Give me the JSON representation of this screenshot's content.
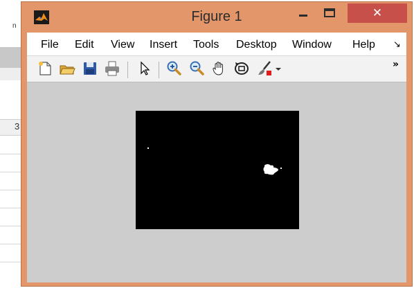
{
  "background_app": {
    "cell_value": "3",
    "top_fragment": "n"
  },
  "window": {
    "title": "Figure 1",
    "close_glyph": "✕",
    "frame_color": "#e3966a",
    "close_color": "#c7504b"
  },
  "menu": {
    "items": [
      "File",
      "Edit",
      "View",
      "Insert",
      "Tools",
      "Desktop",
      "Window",
      "Help"
    ],
    "overflow_glyph": "↘"
  },
  "toolbar": {
    "icons": [
      "new-figure-icon",
      "open-file-icon",
      "save-icon",
      "print-icon",
      "edit-plot-arrow-icon",
      "zoom-in-icon",
      "zoom-out-icon",
      "pan-hand-icon",
      "rotate-3d-icon",
      "data-cursor-brush-icon",
      "dropdown-arrow-icon"
    ],
    "overflow_glyph": "»"
  },
  "figure": {
    "image_background": "#000000",
    "canvas_color": "#cdcdcd"
  }
}
